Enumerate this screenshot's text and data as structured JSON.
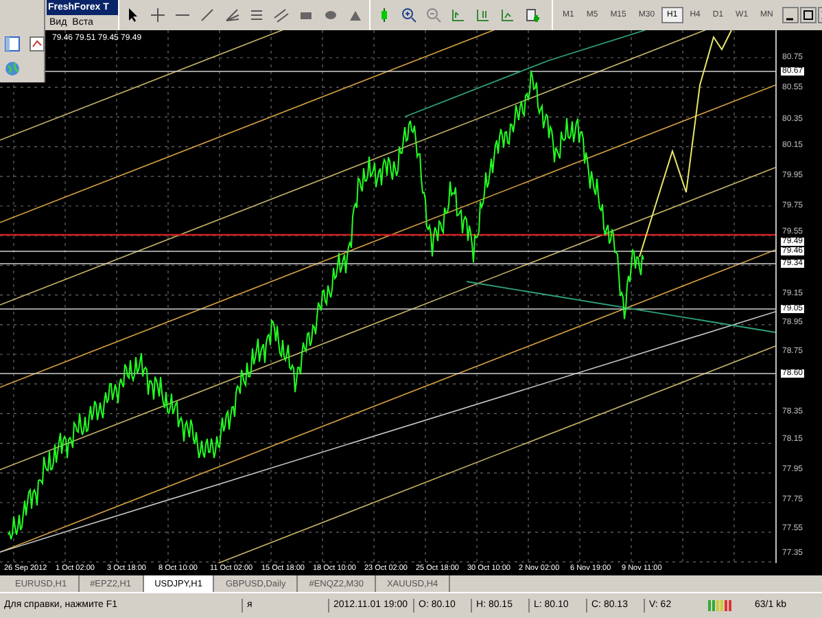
{
  "window": {
    "title": "FreshForex T",
    "menu": [
      "Вид",
      "Вста"
    ]
  },
  "timeframes": [
    {
      "label": "M1",
      "selected": false
    },
    {
      "label": "M5",
      "selected": false
    },
    {
      "label": "M15",
      "selected": false
    },
    {
      "label": "M30",
      "selected": false
    },
    {
      "label": "H1",
      "selected": true
    },
    {
      "label": "H4",
      "selected": false
    },
    {
      "label": "D1",
      "selected": false
    },
    {
      "label": "W1",
      "selected": false
    },
    {
      "label": "MN",
      "selected": false
    }
  ],
  "chart": {
    "ohlc_readout": "79.46 79.51 79.45 79.49",
    "price_axis": [
      {
        "label": "80.75",
        "kind": "tick"
      },
      {
        "label": "80.67",
        "kind": "marker"
      },
      {
        "label": "80.55",
        "kind": "tick"
      },
      {
        "label": "80.35",
        "kind": "tick"
      },
      {
        "label": "80.15",
        "kind": "tick"
      },
      {
        "label": "79.95",
        "kind": "tick"
      },
      {
        "label": "79.75",
        "kind": "tick"
      },
      {
        "label": "79.55",
        "kind": "tick"
      },
      {
        "label": "79.49",
        "kind": "marker"
      },
      {
        "label": "79.46",
        "kind": "marker"
      },
      {
        "label": "79.34",
        "kind": "marker"
      },
      {
        "label": "79.15",
        "kind": "tick"
      },
      {
        "label": "79.05",
        "kind": "marker"
      },
      {
        "label": "78.95",
        "kind": "tick"
      },
      {
        "label": "78.75",
        "kind": "tick"
      },
      {
        "label": "78.60",
        "kind": "marker"
      },
      {
        "label": "78.35",
        "kind": "tick"
      },
      {
        "label": "78.15",
        "kind": "tick"
      },
      {
        "label": "77.95",
        "kind": "tick"
      },
      {
        "label": "77.75",
        "kind": "tick"
      },
      {
        "label": "77.55",
        "kind": "tick"
      },
      {
        "label": "77.35",
        "kind": "tick"
      }
    ],
    "time_axis": [
      "26 Sep 2012",
      "1 Oct 02:00",
      "3 Oct 18:00",
      "8 Oct 10:00",
      "11 Oct 02:00",
      "15 Oct 18:00",
      "18 Oct 10:00",
      "23 Oct 02:00",
      "25 Oct 18:00",
      "30 Oct 10:00",
      "2 Nov 02:00",
      "6 Nov 19:00",
      "9 Nov 11:00"
    ]
  },
  "tabs": [
    {
      "label": "EURUSD,H1",
      "selected": false
    },
    {
      "label": "#EPZ2,H1",
      "selected": false
    },
    {
      "label": "USDJPY,H1",
      "selected": true
    },
    {
      "label": "GBPUSD,Daily",
      "selected": false
    },
    {
      "label": "#ENQZ2,M30",
      "selected": false
    },
    {
      "label": "XAUUSD,H4",
      "selected": false
    }
  ],
  "status_bar": {
    "help": "Для справки, нажмите F1",
    "profile": "я",
    "datetime": "2012.11.01 19:00",
    "open": "O: 80.10",
    "high": "H: 80.15",
    "low": "L: 80.10",
    "close": "C: 80.13",
    "volume": "V: 62",
    "traffic": "63/1 kb"
  }
}
